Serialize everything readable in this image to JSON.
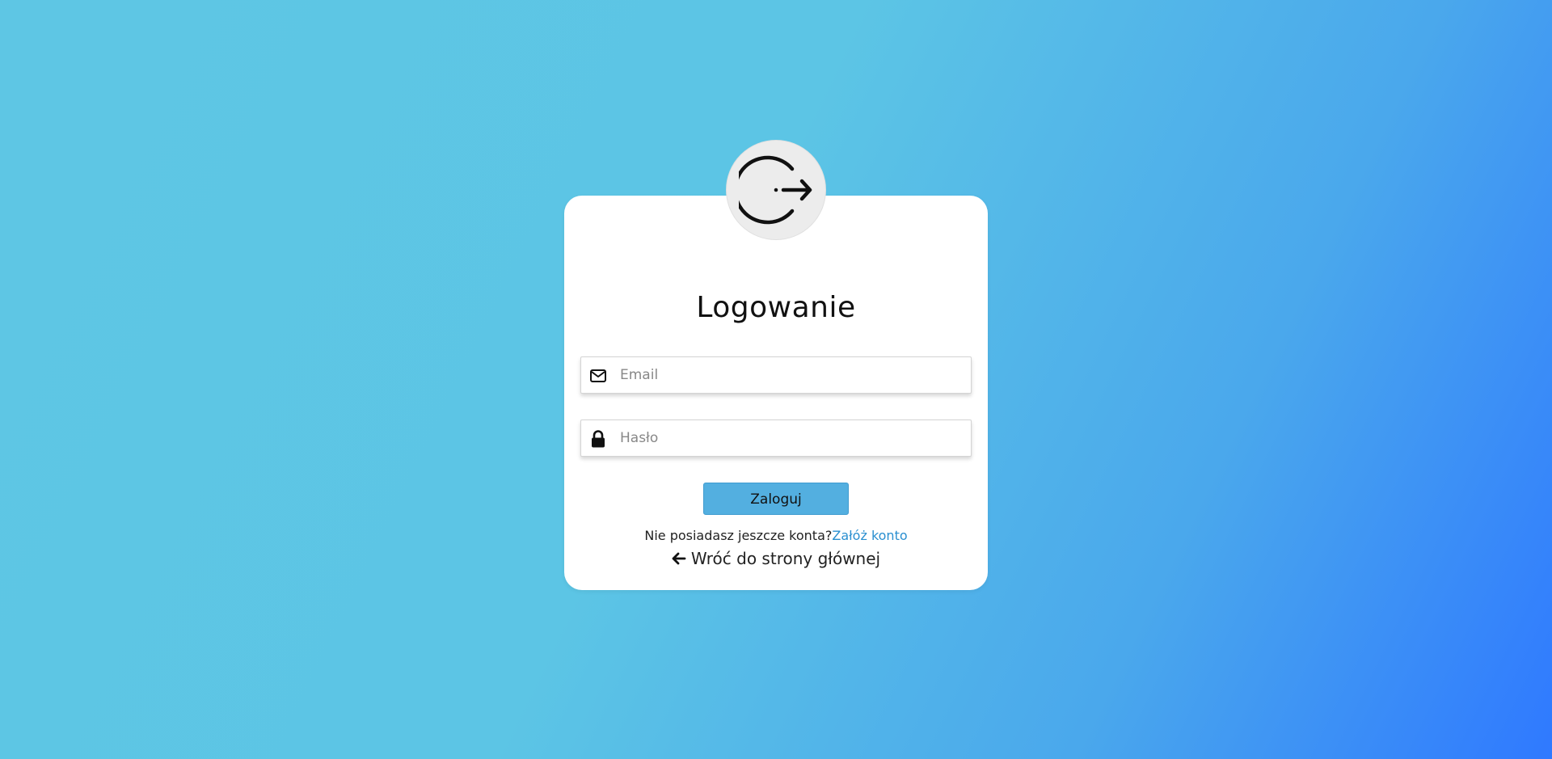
{
  "page": {
    "background_gradient": [
      "#5ec6e4",
      "#5cc5e5",
      "#4aa8ec",
      "#2f79ff"
    ]
  },
  "avatar": {
    "icon": "logout-arrow-icon"
  },
  "form": {
    "title": "Logowanie",
    "email": {
      "icon": "envelope-icon",
      "placeholder": "Email",
      "value": ""
    },
    "password": {
      "icon": "lock-icon",
      "placeholder": "Hasło",
      "value": ""
    },
    "submit_label": "Zaloguj",
    "register_prompt": "Nie posiadasz jeszcze konta?",
    "register_link": "Załóż konto",
    "back_icon": "arrow-left-icon",
    "back_label": "Wróć do strony głównej"
  },
  "colors": {
    "button": "#53afe0",
    "link": "#2a8fd0",
    "card": "#ffffff",
    "avatar_bg": "#ececec"
  }
}
